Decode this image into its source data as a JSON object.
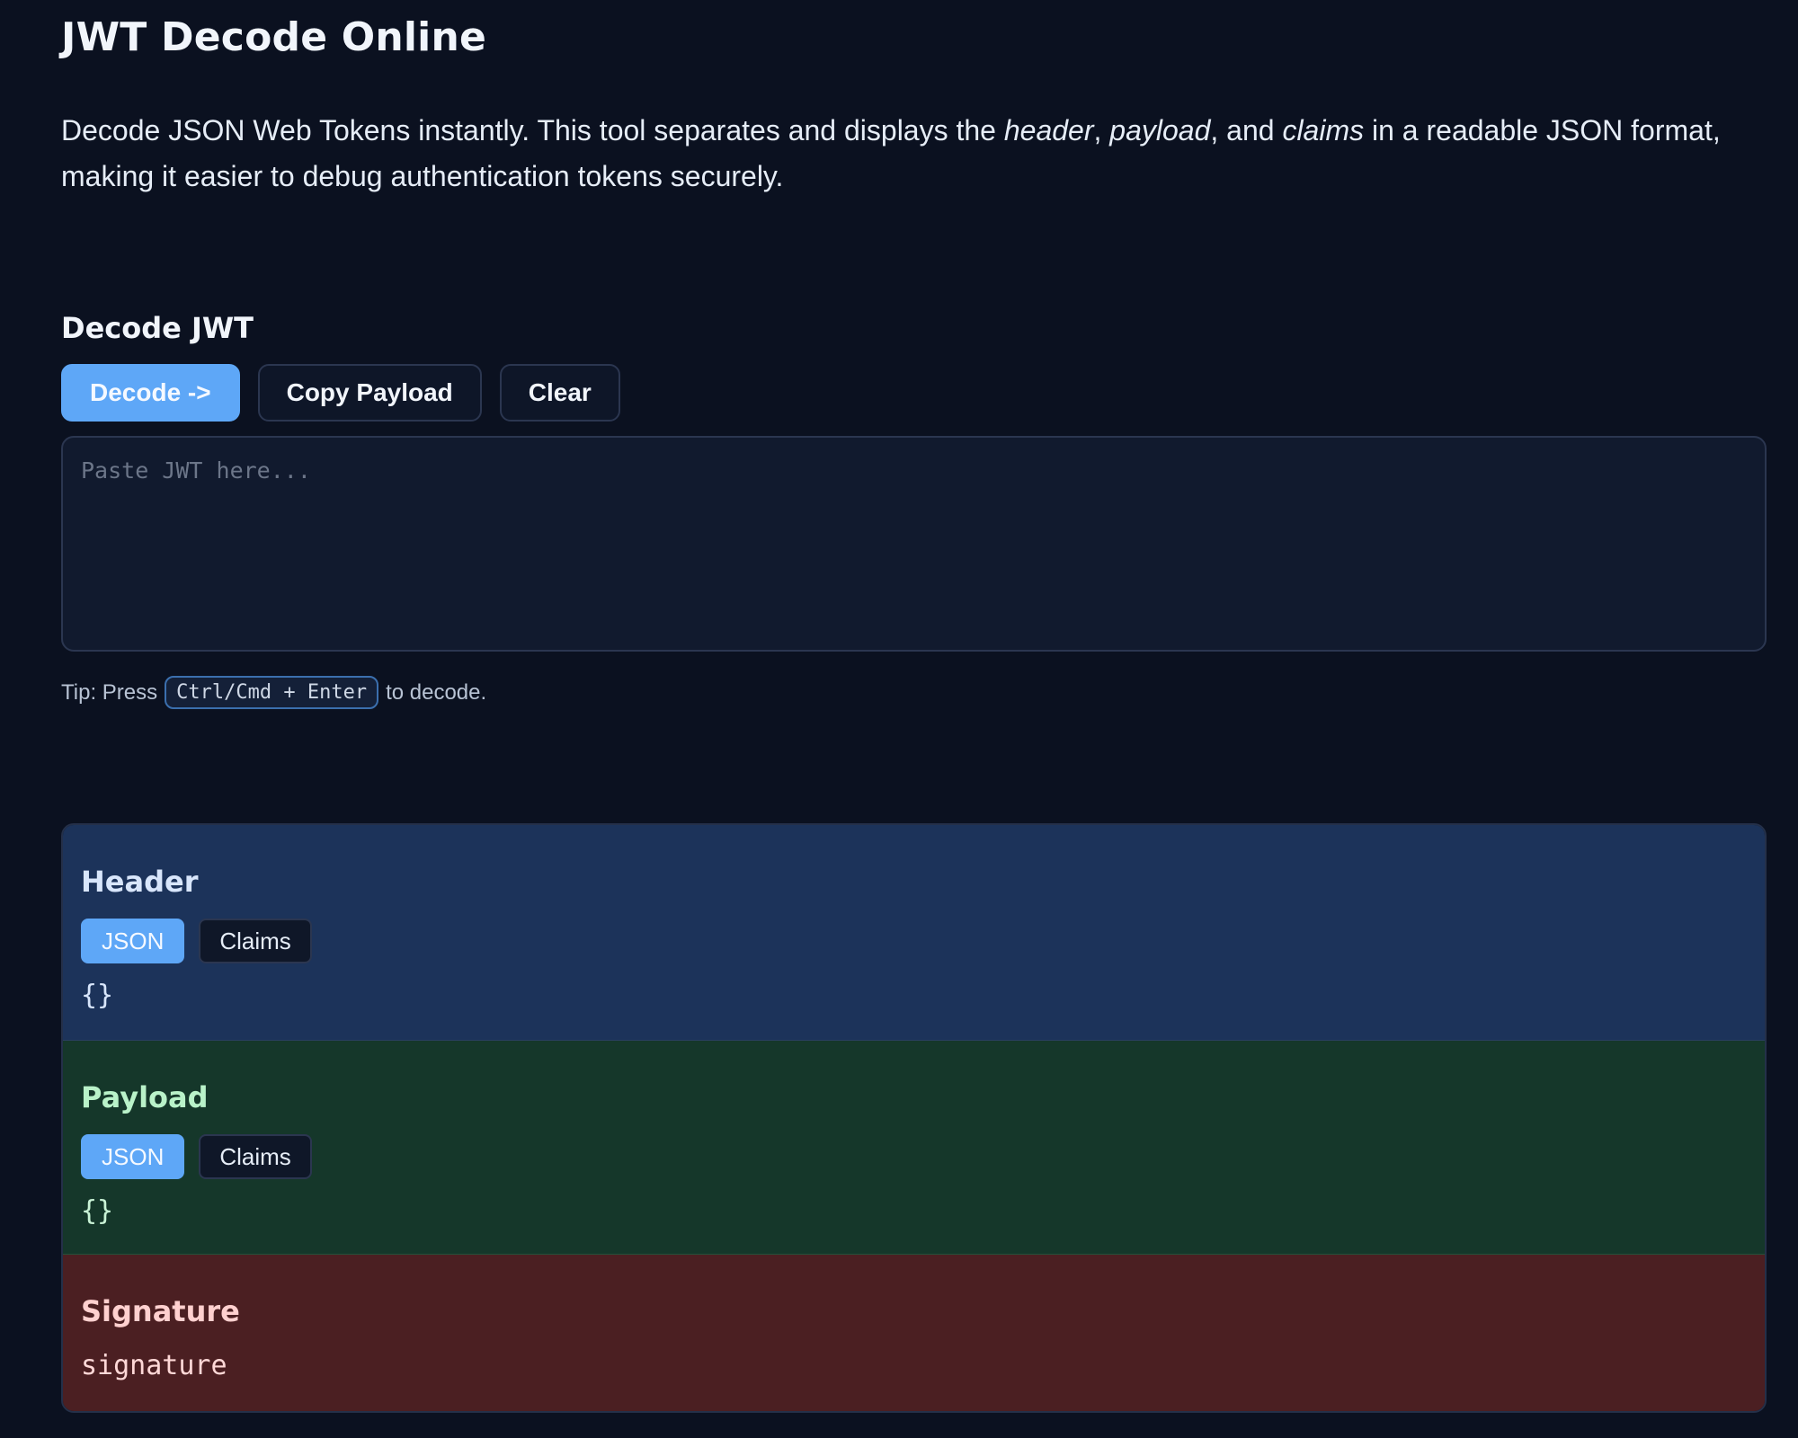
{
  "page": {
    "title": "JWT Decode Online",
    "intro": {
      "part1": "Decode JSON Web Tokens instantly. This tool separates and displays the ",
      "header_word": "header",
      "sep1": ", ",
      "payload_word": "payload",
      "sep2": ", and ",
      "claims_word": "claims",
      "part2": " in a readable JSON format, making it easier to debug authentication tokens securely."
    }
  },
  "decoder": {
    "heading": "Decode JWT",
    "buttons": {
      "decode": "Decode ->",
      "copy_payload": "Copy Payload",
      "clear": "Clear"
    },
    "input": {
      "placeholder": "Paste JWT here...",
      "value": ""
    },
    "tip": {
      "prefix": "Tip: Press",
      "shortcut": "Ctrl/Cmd + Enter",
      "suffix": "to decode."
    }
  },
  "panels": {
    "header": {
      "title": "Header",
      "tabs": [
        {
          "label": "JSON",
          "active": true
        },
        {
          "label": "Claims",
          "active": false
        }
      ],
      "content": "{}"
    },
    "payload": {
      "title": "Payload",
      "tabs": [
        {
          "label": "JSON",
          "active": true
        },
        {
          "label": "Claims",
          "active": false
        }
      ],
      "content": "{}"
    },
    "signature": {
      "title": "Signature",
      "content": "signature"
    }
  },
  "colors": {
    "background": "#0b1120",
    "accent": "#5ea7f7",
    "header_panel": "#1c335a",
    "payload_panel": "#15372a",
    "signature_panel": "#4b1f22"
  }
}
